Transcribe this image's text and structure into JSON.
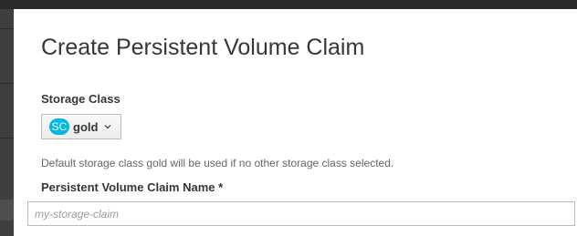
{
  "modal": {
    "title": "Create Persistent Volume Claim",
    "storage_class": {
      "label": "Storage Class",
      "badge": "SC",
      "selected": "gold",
      "icon": "chevron-down-icon",
      "help": "Default storage class gold will be used if no other storage class selected."
    },
    "pvc_name": {
      "label": "Persistent Volume Claim Name *",
      "value": "",
      "placeholder": "my-storage-claim"
    }
  },
  "colors": {
    "badge": "#00b9e4",
    "backdrop": "#3b3b3b"
  }
}
